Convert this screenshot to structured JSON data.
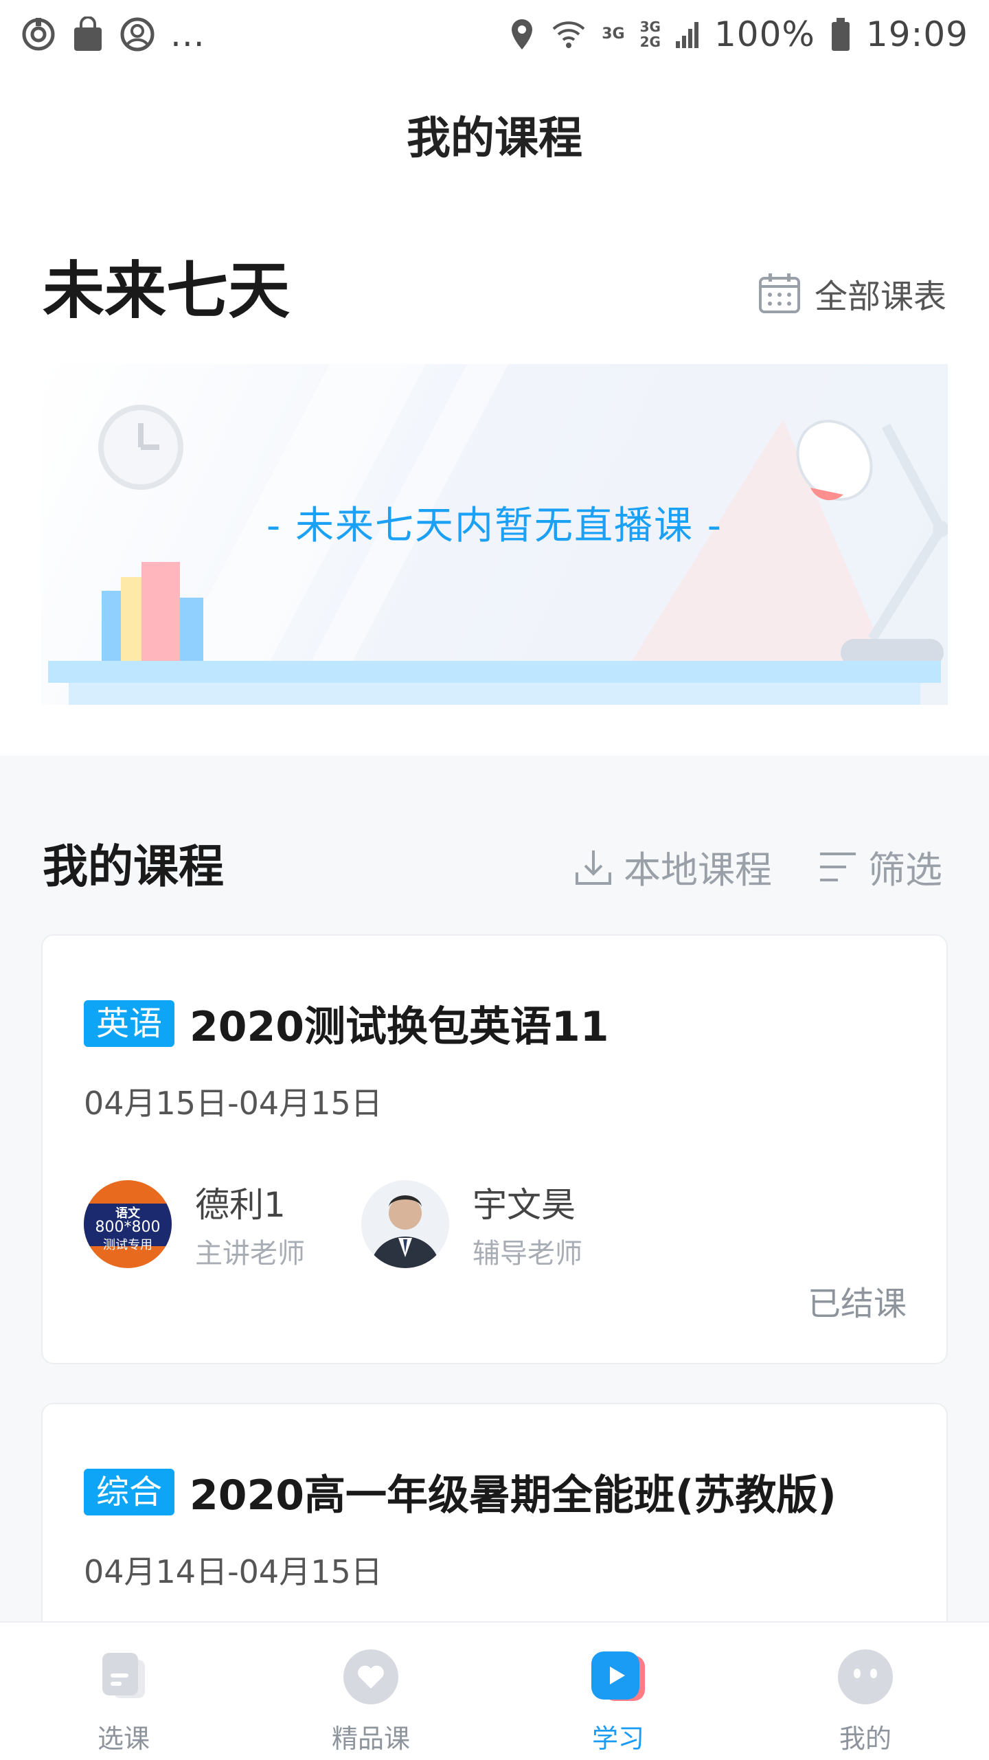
{
  "status_bar": {
    "left_icons": [
      "sync-icon",
      "bag-icon",
      "account-icon",
      "more-icon"
    ],
    "more_text": "...",
    "net_label_1": "3G",
    "net_label_2a": "3G",
    "net_label_2b": "2G",
    "battery": "100%",
    "time": "19:09"
  },
  "header": {
    "title": "我的课程"
  },
  "upcoming": {
    "heading": "未来七天",
    "all_schedule_label": "全部课表",
    "empty_message": "- 未来七天内暂无直播课 -"
  },
  "my_courses": {
    "heading": "我的课程",
    "local_courses_label": "本地课程",
    "filter_label": "筛选",
    "courses": [
      {
        "subject": "英语",
        "title": "2020测试换包英语11",
        "date_range": "04月15日-04月15日",
        "teachers": [
          {
            "name": "德利1",
            "role": "主讲老师",
            "avatar_text_1": "语文",
            "avatar_text_2": "800*800",
            "avatar_text_3": "测试专用"
          },
          {
            "name": "宇文昊",
            "role": "辅导老师"
          }
        ],
        "status": "已结课"
      },
      {
        "subject": "综合",
        "title": "2020高一年级暑期全能班(苏教版)",
        "date_range": "04月14日-04月15日"
      }
    ]
  },
  "bottom_nav": {
    "items": [
      {
        "label": "选课",
        "icon": "course-select-icon"
      },
      {
        "label": "精品课",
        "icon": "heart-icon"
      },
      {
        "label": "学习",
        "icon": "play-icon"
      },
      {
        "label": "我的",
        "icon": "face-icon"
      }
    ],
    "active_index": 2
  },
  "colors": {
    "accent": "#1a9cf5",
    "badge": "#0ea5f7",
    "muted": "#9aa0a8"
  }
}
